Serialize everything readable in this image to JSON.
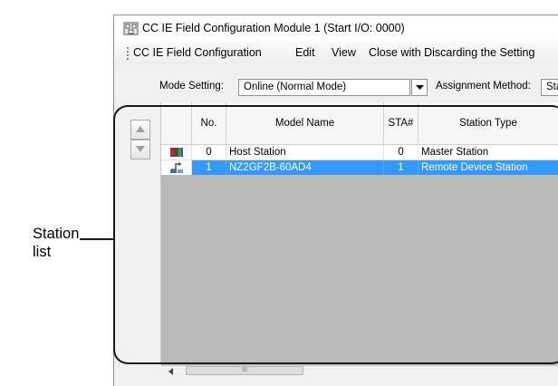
{
  "window": {
    "title": "CC IE Field Configuration Module 1 (Start I/O: 0000)"
  },
  "menu": {
    "items": [
      "CC IE Field Configuration",
      "Edit",
      "View",
      "Close with Discarding the Setting"
    ]
  },
  "settings": {
    "mode_label": "Mode Setting:",
    "mode_value": "Online (Normal Mode)",
    "assignment_label": "Assignment Method:",
    "assignment_value": "Sta"
  },
  "table": {
    "columns": [
      "No.",
      "Model Name",
      "STA#",
      "Station Type"
    ],
    "rows": [
      {
        "no": "0",
        "model": "Host Station",
        "sta": "0",
        "type": "Master Station",
        "icon": "master-station-icon",
        "selected": false
      },
      {
        "no": "1",
        "model": "NZ2GF2B-60AD4",
        "sta": "1",
        "type": "Remote Device Station",
        "icon": "remote-device-icon",
        "selected": true
      }
    ],
    "selection_color": "#3399ff"
  },
  "callout": {
    "line1": "Station",
    "line2": "list"
  },
  "scrollbar": {
    "thumb_grip": "III"
  }
}
